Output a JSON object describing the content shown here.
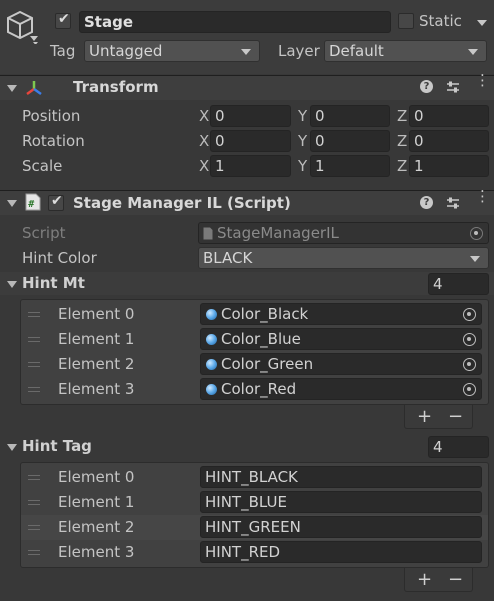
{
  "gameobject": {
    "name": "Stage",
    "active": true,
    "static_label": "Static",
    "static": false,
    "tag_label": "Tag",
    "tag_value": "Untagged",
    "layer_label": "Layer",
    "layer_value": "Default"
  },
  "transform": {
    "title": "Transform",
    "rows": [
      {
        "label": "Position",
        "x": "0",
        "y": "0",
        "z": "0"
      },
      {
        "label": "Rotation",
        "x": "0",
        "y": "0",
        "z": "0"
      },
      {
        "label": "Scale",
        "x": "1",
        "y": "1",
        "z": "1"
      }
    ],
    "axis_x": "X",
    "axis_y": "Y",
    "axis_z": "Z"
  },
  "script_component": {
    "title": "Stage Manager IL (Script)",
    "enabled": true,
    "script_label": "Script",
    "script_value": "StageManagerIL",
    "hint_color_label": "Hint Color",
    "hint_color_value": "BLACK"
  },
  "hint_mt": {
    "label": "Hint Mt",
    "size": "4",
    "elements": [
      {
        "label": "Element 0",
        "value": "Color_Black"
      },
      {
        "label": "Element 1",
        "value": "Color_Blue"
      },
      {
        "label": "Element 2",
        "value": "Color_Green"
      },
      {
        "label": "Element 3",
        "value": "Color_Red"
      }
    ],
    "add": "+",
    "remove": "−"
  },
  "hint_tag": {
    "label": "Hint Tag",
    "size": "4",
    "elements": [
      {
        "label": "Element 0",
        "value": "HINT_BLACK"
      },
      {
        "label": "Element 1",
        "value": "HINT_BLUE"
      },
      {
        "label": "Element 2",
        "value": "HINT_GREEN"
      },
      {
        "label": "Element 3",
        "value": "HINT_RED"
      }
    ],
    "add": "+",
    "remove": "−"
  },
  "icons": {
    "gameobject": "cube-icon",
    "transform": "transform-axes-icon",
    "script": "script-file-icon",
    "help": "help-icon",
    "presets": "presets-icon",
    "menu": "kebab-menu-icon",
    "object": "material-sphere-icon",
    "picker": "object-picker-icon"
  }
}
